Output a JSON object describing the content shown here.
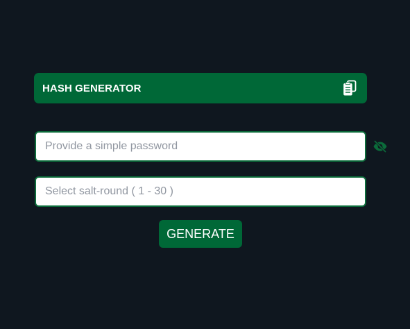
{
  "header": {
    "title": "HASH GENERATOR",
    "copy_icon": "copy-clipboard-icon"
  },
  "form": {
    "password_placeholder": "Provide a simple password",
    "password_value": "",
    "visibility_icon": "eye-slash-icon",
    "salt_placeholder": "Select salt-round ( 1 - 30 )",
    "salt_value": "",
    "generate_label": "GENERATE"
  },
  "colors": {
    "background": "#0f171f",
    "accent": "#006837",
    "input_border": "#0b6b3a",
    "eye_icon": "#0b6b3a"
  }
}
